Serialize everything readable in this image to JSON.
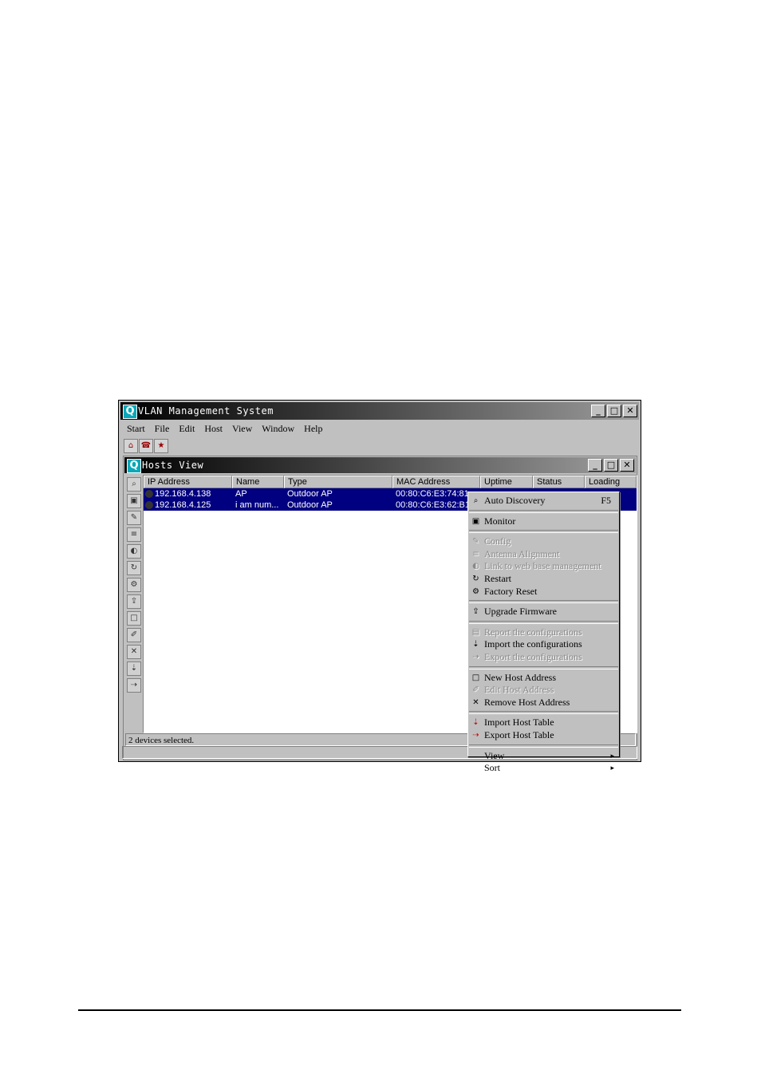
{
  "app": {
    "title": "VLAN Management System"
  },
  "menubar": [
    "Start",
    "File",
    "Edit",
    "Host",
    "View",
    "Window",
    "Help"
  ],
  "child_window": {
    "title": "Hosts View"
  },
  "table": {
    "columns": [
      "IP Address",
      "Name",
      "Type",
      "MAC Address",
      "Uptime",
      "Status",
      "Loading"
    ],
    "rows": [
      {
        "ip": "192.168.4.138",
        "name": "AP",
        "type": "Outdoor AP",
        "mac": "00:80:C6:E3:74:81"
      },
      {
        "ip": "192.168.4.125",
        "name": "i am num...",
        "type": "Outdoor AP",
        "mac": "00:80:C6:E3:62:B1"
      }
    ]
  },
  "status": {
    "text": "2 devices selected."
  },
  "context_menu": {
    "auto_discovery": "Auto Discovery",
    "auto_discovery_shortcut": "F5",
    "monitor": "Monitor",
    "config": "Config",
    "antenna": "Antenna Alignment",
    "link_web": "Link to web base management",
    "restart": "Restart",
    "factory_reset": "Factory Reset",
    "upgrade_firmware": "Upgrade Firmware",
    "report_config": "Report the configurations",
    "import_config": "Import the configurations",
    "export_config": "Export the configurations",
    "new_host": "New Host Address",
    "edit_host": "Edit Host Address",
    "remove_host": "Remove Host Address",
    "import_table": "Import Host Table",
    "export_table": "Export Host Table",
    "view": "View",
    "sort": "Sort"
  }
}
